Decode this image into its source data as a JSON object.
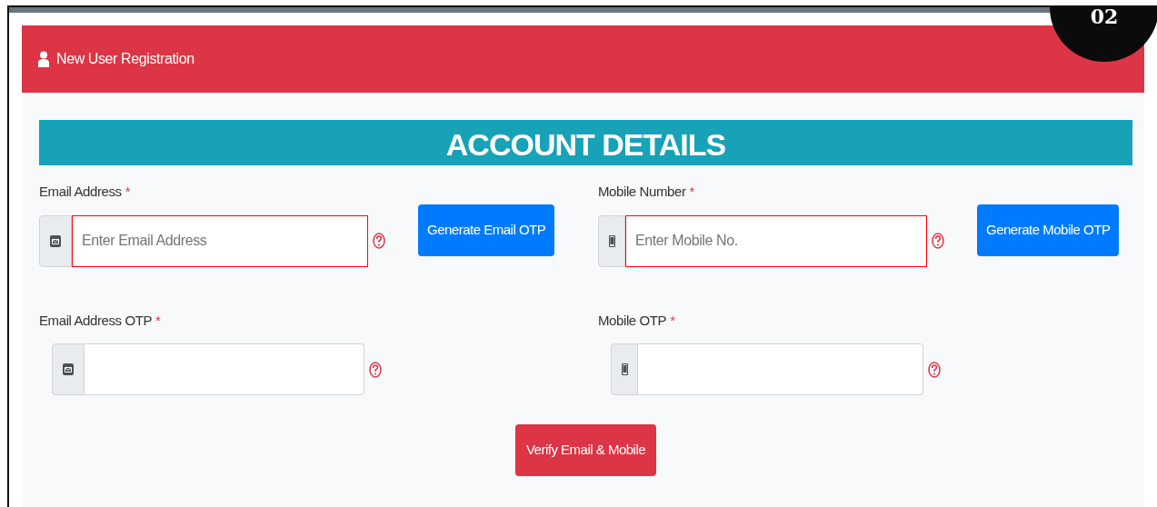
{
  "step_badge": "02",
  "card": {
    "title": "New User Registration"
  },
  "section": {
    "title": "ACCOUNT DETAILS"
  },
  "fields": [
    {
      "label": "Email Address",
      "required_mark": "*",
      "kind": "email",
      "placeholder": "Enter Email Address",
      "invalid": true,
      "button": "Generate Email OTP"
    },
    {
      "label": "Mobile Number",
      "required_mark": "*",
      "kind": "mobile",
      "placeholder": "Enter Mobile No.",
      "invalid": true,
      "button": "Generate Mobile OTP"
    },
    {
      "label": "Email Address OTP",
      "required_mark": "*",
      "kind": "email",
      "invalid": false
    },
    {
      "label": "Mobile OTP",
      "required_mark": "*",
      "kind": "mobile",
      "invalid": false
    }
  ],
  "submit": "Verify Email & Mobile"
}
